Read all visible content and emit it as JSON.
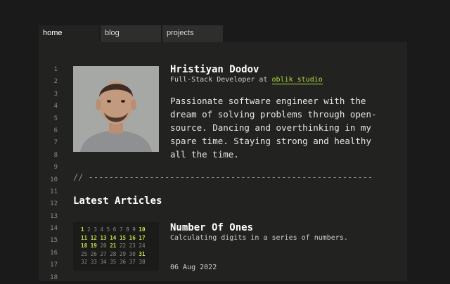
{
  "tabs": [
    {
      "label": "home"
    },
    {
      "label": "blog"
    },
    {
      "label": "projects"
    }
  ],
  "gutter": {
    "lines": [
      "1",
      "2",
      "3",
      "4",
      "5",
      "6",
      "7",
      "8",
      "9",
      "10",
      "11",
      "12",
      "13",
      "14",
      "15",
      "16",
      "17",
      "18"
    ]
  },
  "profile": {
    "name": "Hristiyan Dodov",
    "role_prefix": "Full-Stack Developer at",
    "company": "oblik studio",
    "bio": "Passionate software engineer with the dream of solving problems through open-source. Dancing and overthinking in my spare time. Staying strong and healthy all the time."
  },
  "divider": {
    "text": "// ---------------------------------------------------------"
  },
  "articles_section": {
    "title": "Latest Articles"
  },
  "articles": [
    {
      "title": "Number Of Ones",
      "description": "Calculating digits in a series of numbers.",
      "date": "06 Aug 2022",
      "thumbnail": {
        "rows": [
          [
            "1",
            "2",
            "3",
            "4",
            "5",
            "6",
            "7",
            "8",
            "9",
            "10"
          ],
          [
            "11",
            "12",
            "13",
            "14",
            "15",
            "16",
            "17"
          ],
          [
            "18",
            "19",
            "20",
            "21",
            "22",
            "23",
            "24"
          ],
          [
            "25",
            "26",
            "27",
            "28",
            "29",
            "30",
            "31"
          ],
          [
            "32",
            "33",
            "34",
            "35",
            "36",
            "37",
            "38"
          ]
        ],
        "highlighted": [
          "1",
          "10",
          "11",
          "12",
          "13",
          "14",
          "15",
          "16",
          "17",
          "18",
          "19",
          "21",
          "31"
        ]
      }
    }
  ],
  "colors": {
    "accent": "#b3d94a",
    "background": "#1a1a1a",
    "panel": "#222220"
  }
}
